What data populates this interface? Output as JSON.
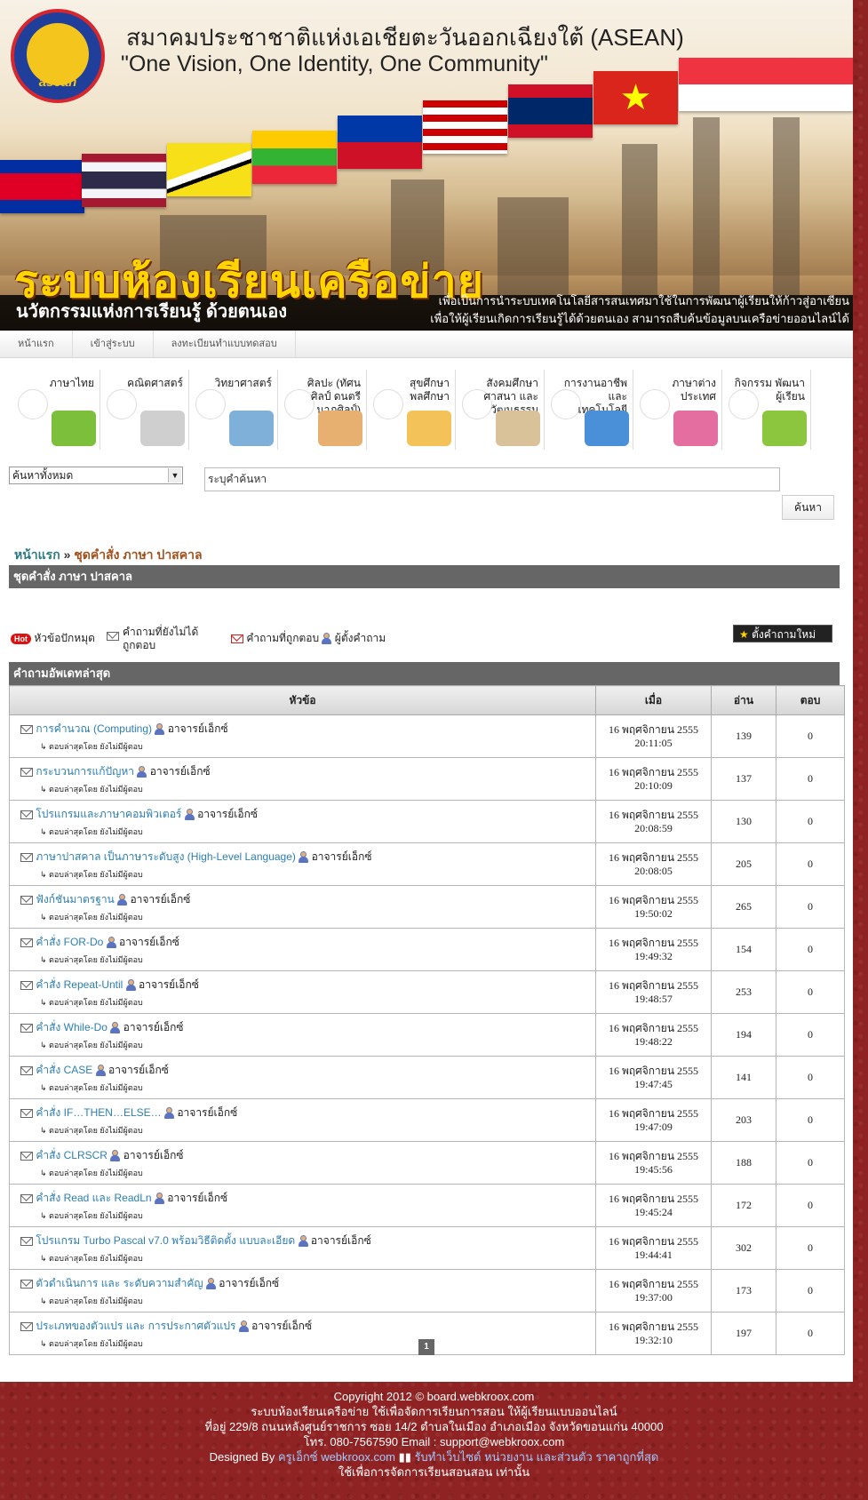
{
  "header": {
    "org_title": "สมาคมประชาชาติแห่งเอเชียตะวันออกเฉียงใต้ (ASEAN)",
    "motto": "\"One Vision, One Identity, One Community\"",
    "logo_text": "asean",
    "system_title": "ระบบห้องเรียนเครือข่าย",
    "system_subtitle": "นวัตกรรมแห่งการเรียนรู้ ด้วยตนเอง",
    "desc_line1": "เพื่อเป็นการนำระบบเทคโนโลยีสารสนเทศมาใช้ในการพัฒนาผู้เรียนให้ก้าวสู่อาเซียน",
    "desc_line2": "เพื่อให้ผู้เรียนเกิดการเรียนรู้ได้ด้วยตนเอง สามารถสืบค้นข้อมูลบนเครือข่ายออนไลน์ได้"
  },
  "nav": [
    "หน้าแรก",
    "เข้าสู่ระบบ",
    "ลงทะเบียนทำแบบทดสอบ"
  ],
  "categories": [
    {
      "label": "ภาษาไทย",
      "color": "#7bbf3a"
    },
    {
      "label": "คณิตศาสตร์",
      "color": "#cfcfcf"
    },
    {
      "label": "วิทยาศาสตร์",
      "color": "#7fb0d9"
    },
    {
      "label": "ศิลปะ (ทัศนศิลป์ ดนตรี นาฏศิลป์)",
      "color": "#e8b070"
    },
    {
      "label": "สุขศึกษา พลศึกษา",
      "color": "#f3c35a"
    },
    {
      "label": "สังคมศึกษา ศาสนา และวัฒนธรรม",
      "color": "#d9c29a"
    },
    {
      "label": "การงานอาชีพและ เทคโนโลยี",
      "color": "#4a90d9"
    },
    {
      "label": "ภาษาต่างประเทศ",
      "color": "#e56ea0"
    },
    {
      "label": "กิจกรรม พัฒนาผู้เรียน",
      "color": "#8cc63f"
    }
  ],
  "search": {
    "scope": "ค้นหาทั้งหมด",
    "placeholder": "ระบุคำค้นหา",
    "button": "ค้นหา"
  },
  "breadcrumb": {
    "home": "หน้าแรก",
    "sep": "»",
    "current": "ชุดคำสั่ง ภาษา ปาสคาล"
  },
  "board_title": "ชุดคำสั่ง ภาษา ปาสคาล",
  "legend": {
    "hot_badge": "Hot",
    "pinned": "หัวข้อปักหมุด",
    "unanswered": "คำถามที่ยังไม่ได้ถูกตอบ",
    "answered": "คำถามที่ถูกตอบ",
    "asker": "ผู้ตั้งคำถาม"
  },
  "new_question_button": "ตั้งคำถามใหม่",
  "latest_title": "คำถามอัพเดทล่าสุด",
  "table": {
    "columns": [
      "หัวข้อ",
      "เมื่อ",
      "อ่าน",
      "ตอบ"
    ],
    "last_reply_prefix": "↳ ตอบล่าสุดโดย",
    "last_reply_none": "ยังไม่มีผู้ตอบ",
    "rows": [
      {
        "title": "การคำนวณ (Computing)",
        "author": "อาจารย์เอ็กซ์",
        "date": "16 พฤศจิกายน 2555",
        "time": "20:11:05",
        "reads": "139",
        "replies": "0"
      },
      {
        "title": "กระบวนการแก้ปัญหา",
        "author": "อาจารย์เอ็กซ์",
        "date": "16 พฤศจิกายน 2555",
        "time": "20:10:09",
        "reads": "137",
        "replies": "0"
      },
      {
        "title": "โปรแกรมและภาษาคอมพิวเตอร์",
        "author": "อาจารย์เอ็กซ์",
        "date": "16 พฤศจิกายน 2555",
        "time": "20:08:59",
        "reads": "130",
        "replies": "0"
      },
      {
        "title": "ภาษาปาสคาล เป็นภาษาระดับสูง (High-Level Language)",
        "author": "อาจารย์เอ็กซ์",
        "date": "16 พฤศจิกายน 2555",
        "time": "20:08:05",
        "reads": "205",
        "replies": "0"
      },
      {
        "title": "ฟังก์ชันมาตรฐาน",
        "author": "อาจารย์เอ็กซ์",
        "date": "16 พฤศจิกายน 2555",
        "time": "19:50:02",
        "reads": "265",
        "replies": "0"
      },
      {
        "title": "คำสั่ง FOR-Do",
        "author": "อาจารย์เอ็กซ์",
        "date": "16 พฤศจิกายน 2555",
        "time": "19:49:32",
        "reads": "154",
        "replies": "0"
      },
      {
        "title": "คำสั่ง Repeat-Until",
        "author": "อาจารย์เอ็กซ์",
        "date": "16 พฤศจิกายน 2555",
        "time": "19:48:57",
        "reads": "253",
        "replies": "0"
      },
      {
        "title": "คำสั่ง While-Do",
        "author": "อาจารย์เอ็กซ์",
        "date": "16 พฤศจิกายน 2555",
        "time": "19:48:22",
        "reads": "194",
        "replies": "0"
      },
      {
        "title": "คำสั่ง CASE",
        "author": "อาจารย์เอ็กซ์",
        "date": "16 พฤศจิกายน 2555",
        "time": "19:47:45",
        "reads": "141",
        "replies": "0"
      },
      {
        "title": "คำสั่ง IF…THEN…ELSE…",
        "author": "อาจารย์เอ็กซ์",
        "date": "16 พฤศจิกายน 2555",
        "time": "19:47:09",
        "reads": "203",
        "replies": "0"
      },
      {
        "title": "คำสั่ง CLRSCR",
        "author": "อาจารย์เอ็กซ์",
        "date": "16 พฤศจิกายน 2555",
        "time": "19:45:56",
        "reads": "188",
        "replies": "0"
      },
      {
        "title": "คำสั่ง Read และ ReadLn",
        "author": "อาจารย์เอ็กซ์",
        "date": "16 พฤศจิกายน 2555",
        "time": "19:45:24",
        "reads": "172",
        "replies": "0"
      },
      {
        "title": "โปรแกรม Turbo Pascal v7.0 พร้อมวิธีติดตั้ง แบบละเอียด",
        "author": "อาจารย์เอ็กซ์",
        "date": "16 พฤศจิกายน 2555",
        "time": "19:44:41",
        "reads": "302",
        "replies": "0"
      },
      {
        "title": "ตัวดำเนินการ และ ระดับความสำคัญ",
        "author": "อาจารย์เอ็กซ์",
        "date": "16 พฤศจิกายน 2555",
        "time": "19:37:00",
        "reads": "173",
        "replies": "0"
      },
      {
        "title": "ประเภทของตัวแปร และ การประกาศตัวแปร",
        "author": "อาจารย์เอ็กซ์",
        "date": "16 พฤศจิกายน 2555",
        "time": "19:32:10",
        "reads": "197",
        "replies": "0"
      }
    ]
  },
  "pager": {
    "current": "1"
  },
  "footer": {
    "line1": "Copyright 2012 © board.webkroox.com",
    "line2": "ระบบห้องเรียนเครือข่าย ใช้เพื่อจัดการเรียนการสอน ให้ผู้เรียนแบบออนไลน์",
    "line3": "ที่อยู่ 229/8 ถนนหลังศูนย์ราชการ ซอย 14/2 ตำบลในเมือง อำเภอเมือง จังหวัดขอนแก่น 40000",
    "line4": "โทร. 080-7567590 Email : support@webkroox.com",
    "designed_by": "Designed By",
    "designer_link": "ครูเอ็กซ์ webkroox.com",
    "service_link": "รับทำเว็บไซต์ หน่วยงาน และส่วนตัว ราคาถูกที่สุด",
    "line6": "ใช้เพื่อการจัดการเรียนสอนสอน เท่านั้น"
  }
}
